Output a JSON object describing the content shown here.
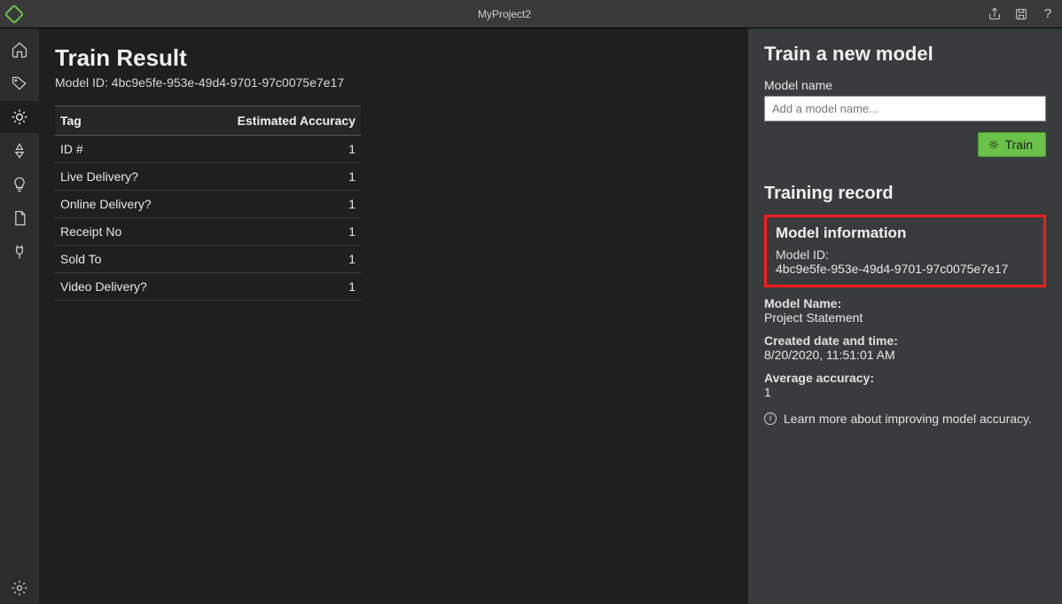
{
  "titlebar": {
    "title": "MyProject2"
  },
  "main": {
    "heading": "Train Result",
    "model_id_label": "Model ID: 4bc9e5fe-953e-49d4-9701-97c0075e7e17",
    "table": {
      "col_tag": "Tag",
      "col_acc": "Estimated Accuracy",
      "rows": [
        {
          "tag": "ID #",
          "acc": "1"
        },
        {
          "tag": "Live Delivery?",
          "acc": "1"
        },
        {
          "tag": "Online Delivery?",
          "acc": "1"
        },
        {
          "tag": "Receipt No",
          "acc": "1"
        },
        {
          "tag": "Sold To",
          "acc": "1"
        },
        {
          "tag": "Video Delivery?",
          "acc": "1"
        }
      ]
    }
  },
  "panel": {
    "title": "Train a new model",
    "model_name_label": "Model name",
    "model_name_placeholder": "Add a model name...",
    "train_button": "Train",
    "record_heading": "Training record",
    "model_info_heading": "Model information",
    "model_id_label": "Model ID:",
    "model_id_value": "4bc9e5fe-953e-49d4-9701-97c0075e7e17",
    "model_name_info_label": "Model Name:",
    "model_name_info_value": "Project Statement",
    "created_label": "Created date and time:",
    "created_value": "8/20/2020, 11:51:01 AM",
    "avg_acc_label": "Average accuracy:",
    "avg_acc_value": "1",
    "learn_more": "Learn more about improving model accuracy."
  }
}
